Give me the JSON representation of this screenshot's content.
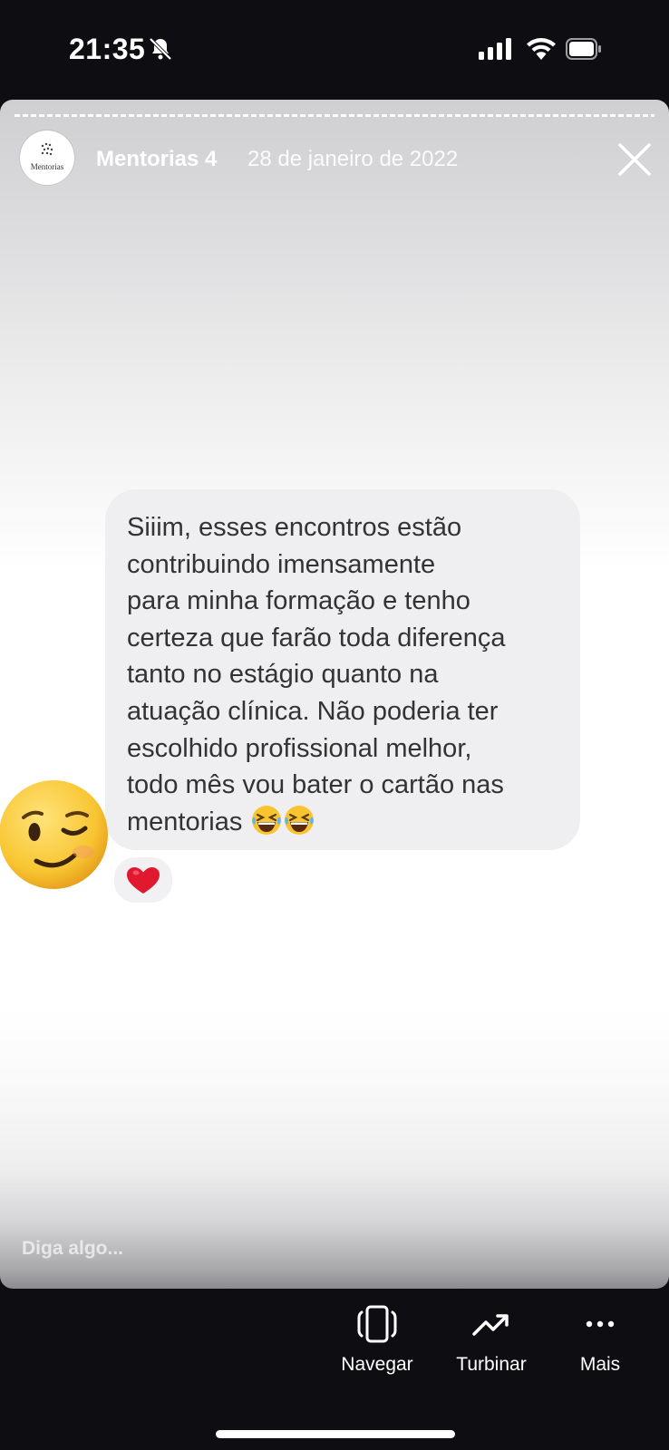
{
  "status_bar": {
    "time": "21:35",
    "icons": [
      "bell-slash-icon",
      "cellular-signal-icon",
      "wifi-icon",
      "battery-icon"
    ]
  },
  "story": {
    "account_name": "Mentorias 4",
    "date": "28 de janeiro de 2022",
    "avatar_text": "Mentorias",
    "message": "Siiim, esses encontros estão\ncontribuindo imensamente\npara minha formação e tenho\ncerteza que farão toda diferença\ntanto no estágio quanto na\natuação clínica. Não poderia ter\nescolhido profissional melhor,\ntodo mês vou bater o cartão nas\nmentorias",
    "message_emojis": [
      "grinning-squinting-face-icon",
      "grinning-squinting-face-icon"
    ],
    "reaction": "heart-icon",
    "sticker": "winking-face-icon",
    "reply_placeholder": "Diga algo..."
  },
  "actions": [
    {
      "label": "Navegar",
      "icon": "phone-navigate-icon"
    },
    {
      "label": "Turbinar",
      "icon": "trending-up-icon"
    },
    {
      "label": "Mais",
      "icon": "more-dots-icon"
    }
  ],
  "colors": {
    "background": "#0e0e12",
    "bubble": "#efeff1",
    "message_text": "#333333",
    "heart": "#e0192f",
    "sticker_yellow": "#f8c531"
  }
}
